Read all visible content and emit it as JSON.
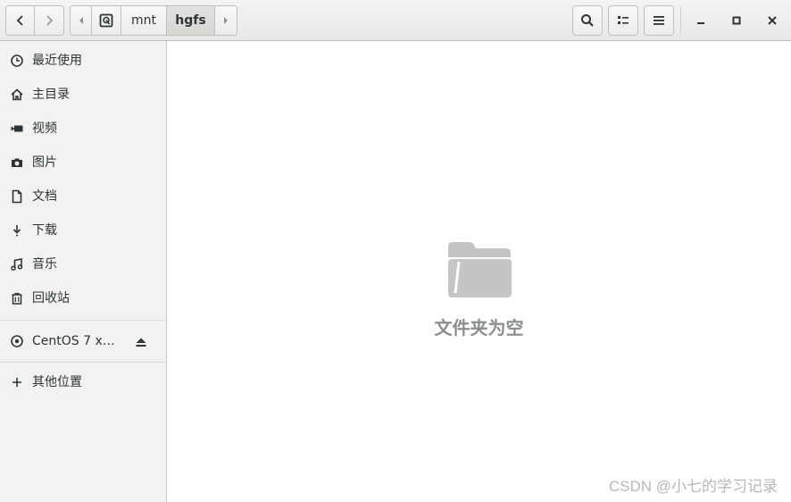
{
  "header": {
    "path": [
      "mnt",
      "hgfs"
    ],
    "icons": {
      "back": "chevron-left-icon",
      "forward": "chevron-right-icon",
      "path_left": "triangle-left-icon",
      "root": "drive-icon",
      "path_right": "triangle-right-icon",
      "search": "search-icon",
      "view": "list-view-icon",
      "menu": "hamburger-menu-icon",
      "minimize": "minimize-icon",
      "maximize": "maximize-icon",
      "close": "close-icon"
    }
  },
  "sidebar": {
    "places": [
      {
        "label": "最近使用",
        "icon": "clock-icon"
      },
      {
        "label": "主目录",
        "icon": "home-icon"
      },
      {
        "label": "视频",
        "icon": "video-camera-icon"
      },
      {
        "label": "图片",
        "icon": "camera-icon"
      },
      {
        "label": "文档",
        "icon": "document-icon"
      },
      {
        "label": "下载",
        "icon": "download-icon"
      },
      {
        "label": "音乐",
        "icon": "music-note-icon"
      },
      {
        "label": "回收站",
        "icon": "trash-icon"
      }
    ],
    "devices": [
      {
        "label": "CentOS 7 x…",
        "icon": "optical-disc-icon",
        "action_icon": "eject-icon"
      }
    ],
    "other": {
      "label": "其他位置",
      "icon": "plus-icon"
    }
  },
  "main": {
    "empty_icon": "folder-icon",
    "empty_text": "文件夹为空",
    "watermark": "CSDN @小七的学习记录"
  },
  "colors": {
    "sidebar_bg": "#f2f2f1",
    "header_bg": "#ececeb",
    "empty_folder": "#c4c6c6",
    "empty_text": "#8b8e8f"
  }
}
